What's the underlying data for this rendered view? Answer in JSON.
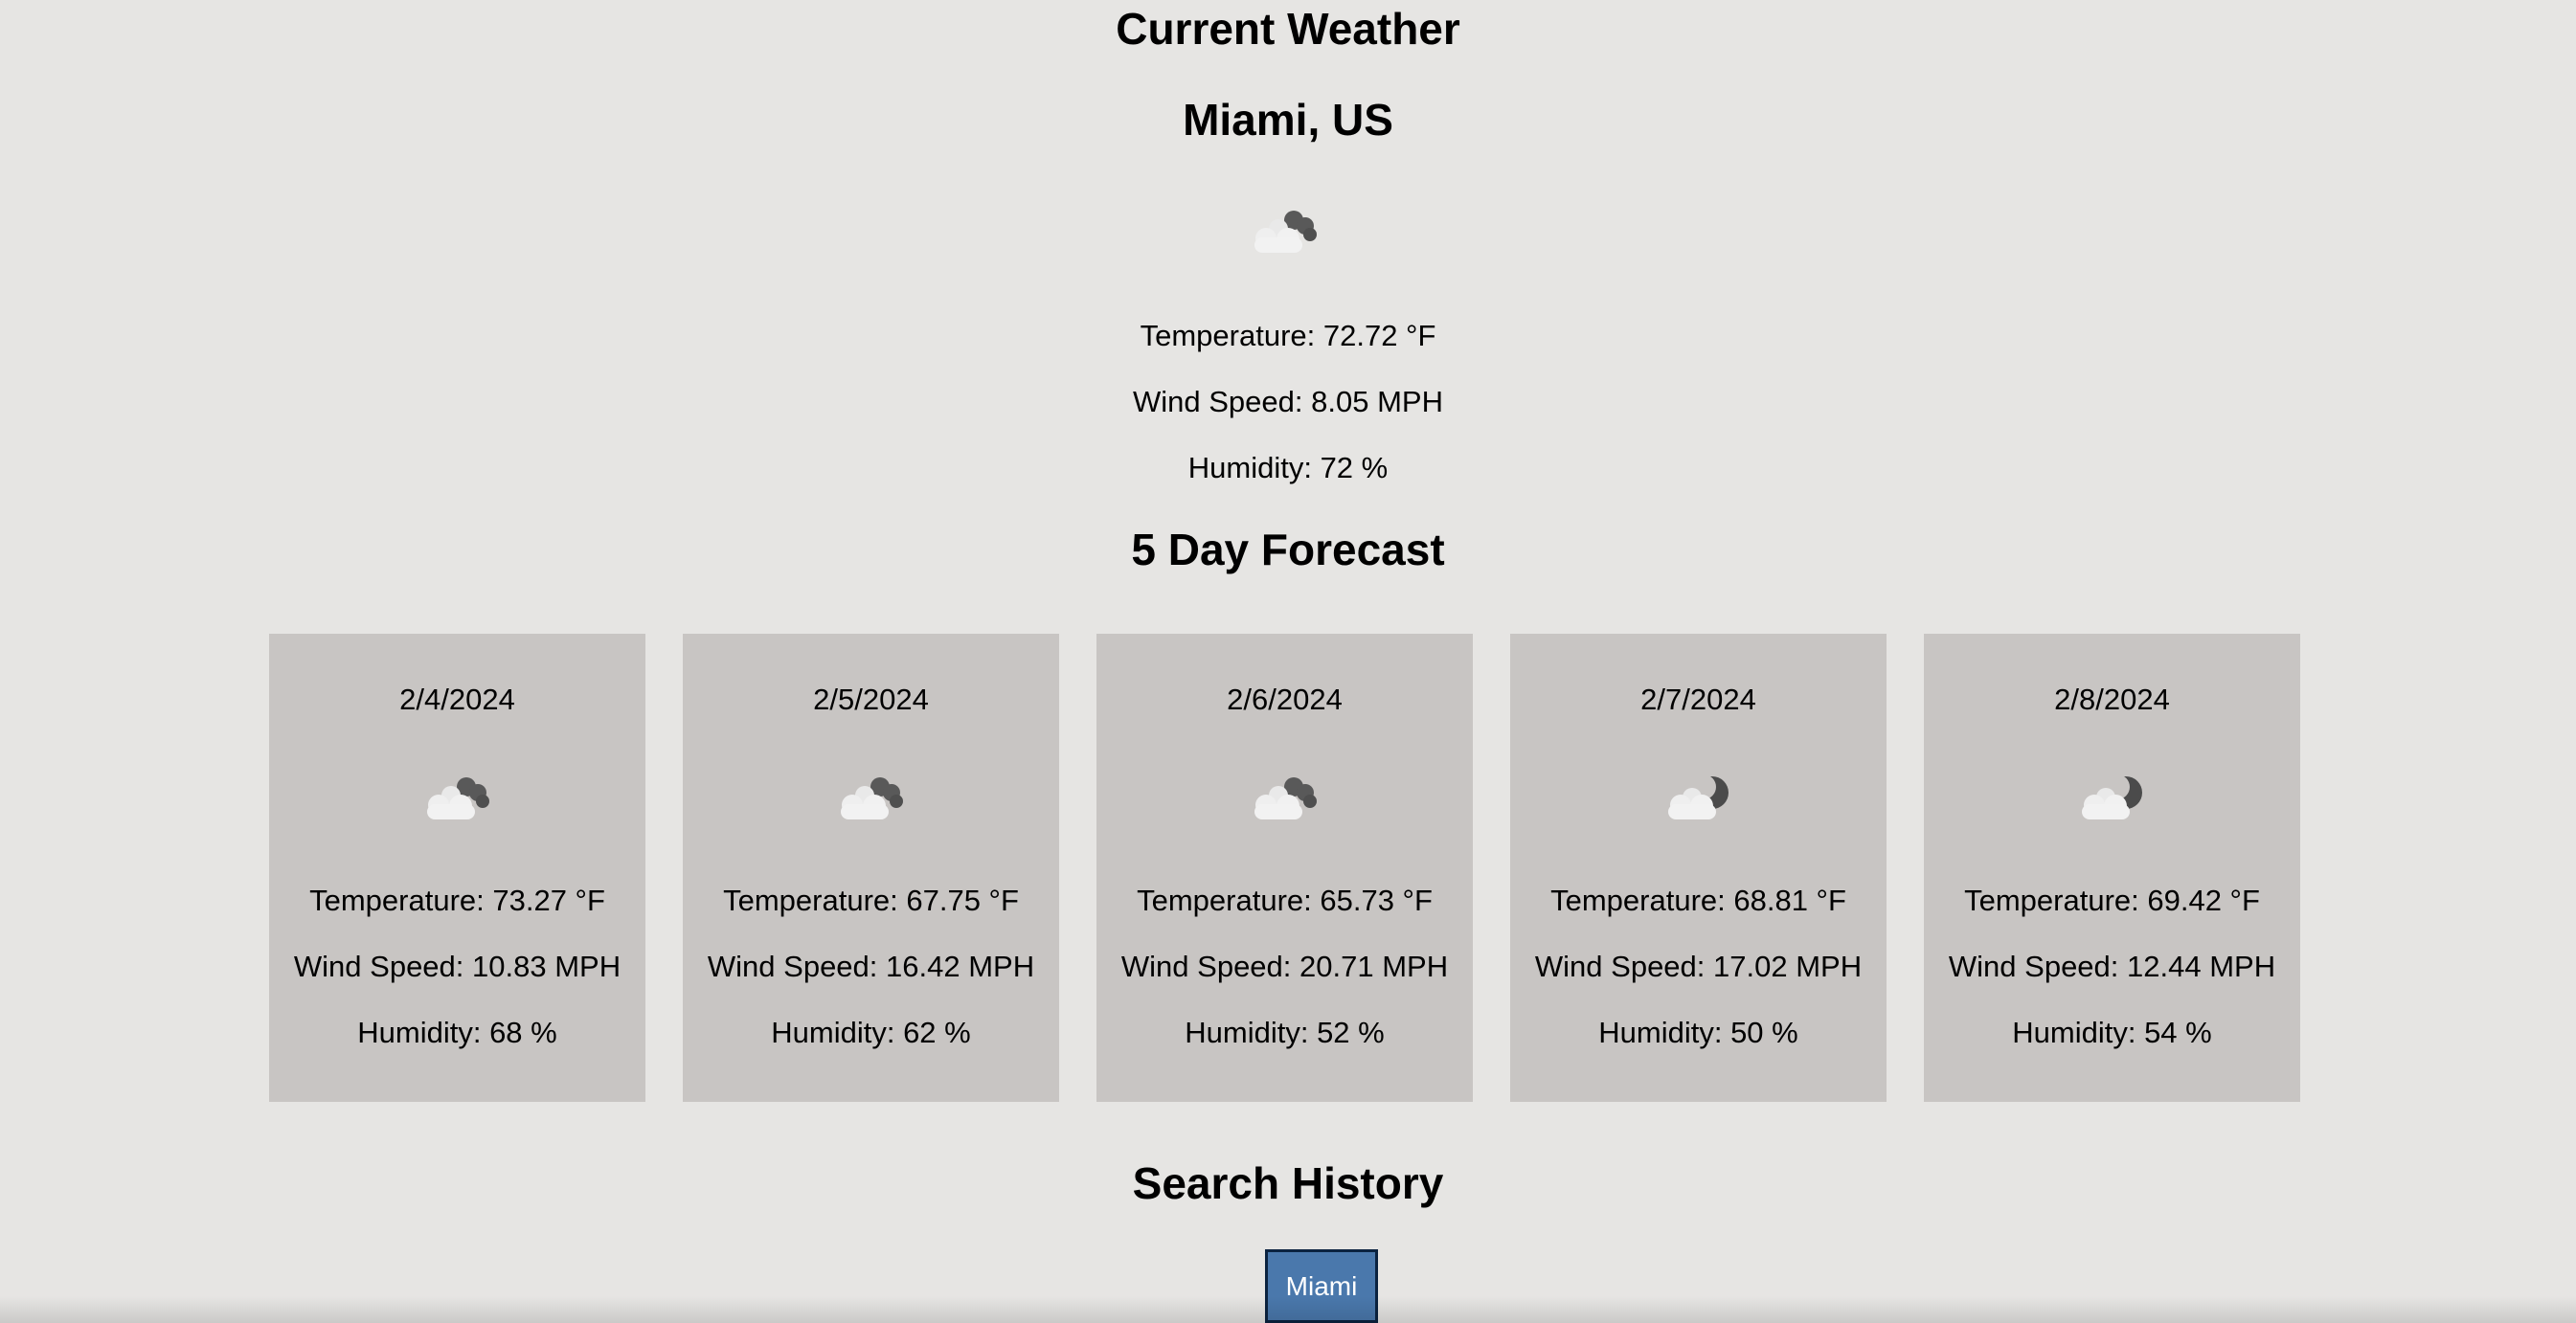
{
  "current": {
    "heading": "Current Weather",
    "city": "Miami, US",
    "icon": "cloud-night-icon",
    "temperature": "Temperature: 72.72 °F",
    "wind": "Wind Speed: 8.05 MPH",
    "humidity": "Humidity: 72 %"
  },
  "forecast": {
    "heading": "5 Day Forecast",
    "days": [
      {
        "date": "2/4/2024",
        "icon": "cloud-night-icon",
        "temperature": "Temperature: 73.27 °F",
        "wind": "Wind Speed: 10.83 MPH",
        "humidity": "Humidity: 68 %"
      },
      {
        "date": "2/5/2024",
        "icon": "cloud-night-icon",
        "temperature": "Temperature: 67.75 °F",
        "wind": "Wind Speed: 16.42 MPH",
        "humidity": "Humidity: 62 %"
      },
      {
        "date": "2/6/2024",
        "icon": "cloud-night-icon",
        "temperature": "Temperature: 65.73 °F",
        "wind": "Wind Speed: 20.71 MPH",
        "humidity": "Humidity: 52 %"
      },
      {
        "date": "2/7/2024",
        "icon": "cloud-moon-icon",
        "temperature": "Temperature: 68.81 °F",
        "wind": "Wind Speed: 17.02 MPH",
        "humidity": "Humidity: 50 %"
      },
      {
        "date": "2/8/2024",
        "icon": "cloud-moon-icon",
        "temperature": "Temperature: 69.42 °F",
        "wind": "Wind Speed: 12.44 MPH",
        "humidity": "Humidity: 54 %"
      }
    ]
  },
  "history": {
    "heading": "Search History",
    "items": [
      {
        "label": "Miami"
      }
    ]
  },
  "colors": {
    "page_background": "#e6e5e3",
    "card_background": "#c8c5c3",
    "button_background": "#4a78ac",
    "button_border": "#0b2340",
    "button_text": "#ffffff"
  }
}
